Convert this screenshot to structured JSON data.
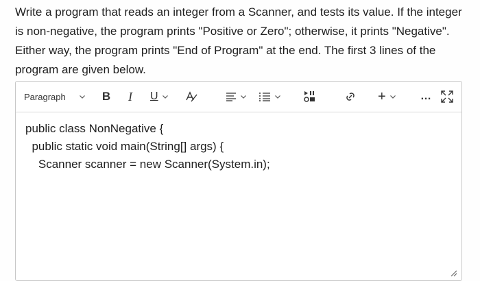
{
  "question": {
    "text": "Write a program that reads an integer from a Scanner, and tests its value. If the integer is non-negative, the program prints \"Positive or Zero\"; otherwise, it prints \"Negative\". Either way, the program prints \"End of Program\" at the end. The first 3 lines of the program are given below."
  },
  "toolbar": {
    "paragraph_label": "Paragraph",
    "bold_label": "B",
    "italic_label": "I",
    "underline_label": "U",
    "add_label": "+",
    "more_label": "…",
    "icons": [
      "chevron-down-icon",
      "text-color-icon",
      "align-icon",
      "list-icon",
      "media-icon",
      "link-icon",
      "plus-icon",
      "more-icon",
      "expand-icon"
    ]
  },
  "editor": {
    "lines": [
      "public class NonNegative {",
      "  public static void main(String[] args) {",
      "    Scanner scanner = new Scanner(System.in);"
    ]
  },
  "colors": {
    "text": "#202020",
    "border": "#c8c8c8",
    "icon": "#333333"
  }
}
